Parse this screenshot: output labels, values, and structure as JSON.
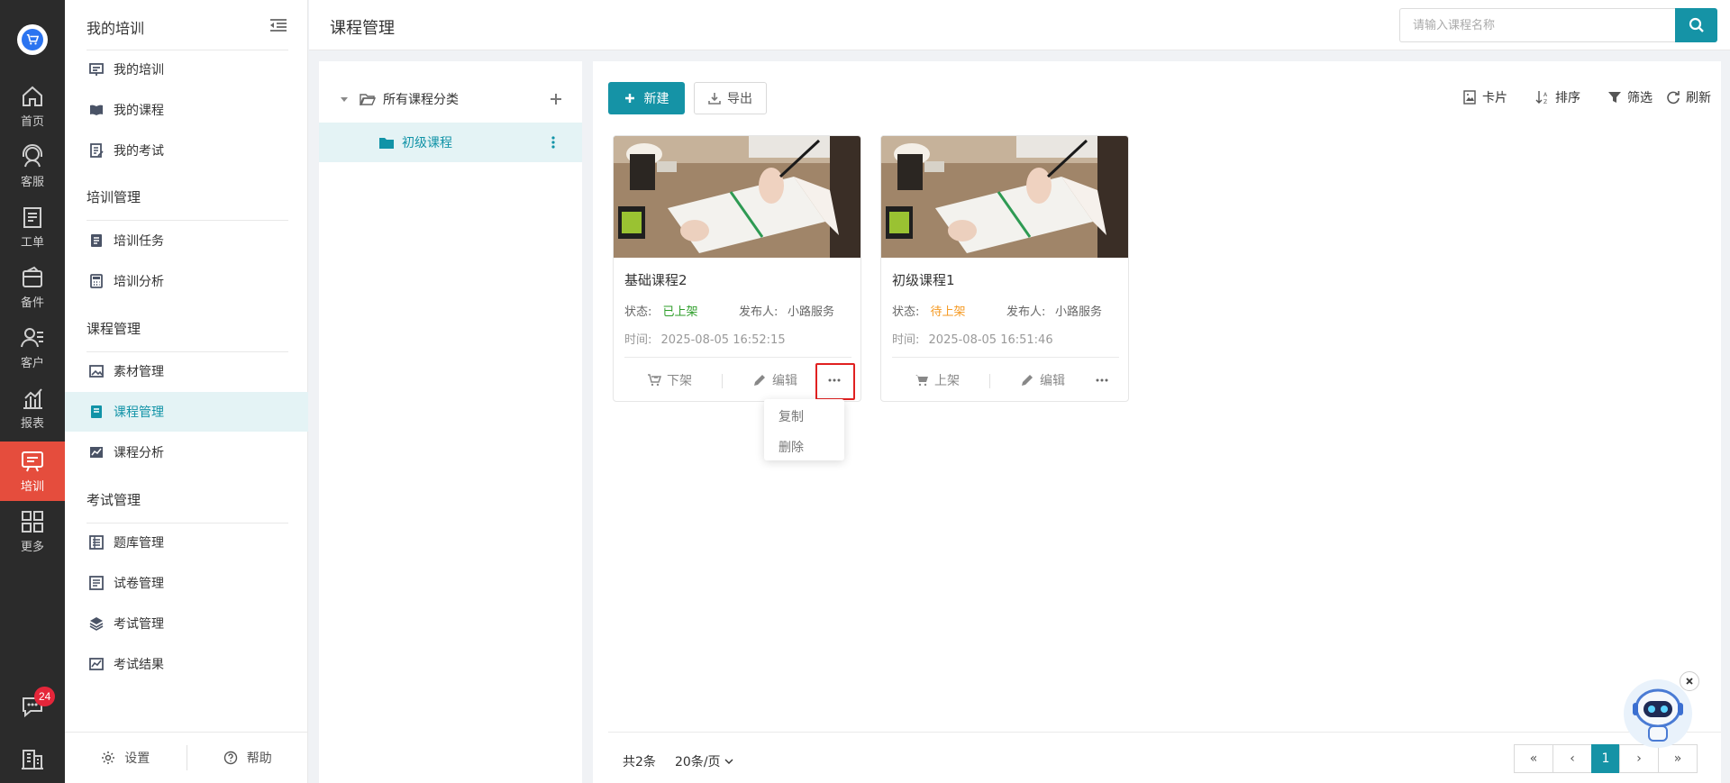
{
  "rail": {
    "items": [
      {
        "label": "首页",
        "icon": "home-icon"
      },
      {
        "label": "客服",
        "icon": "headset-icon"
      },
      {
        "label": "工单",
        "icon": "clipboard-icon"
      },
      {
        "label": "备件",
        "icon": "wallet-icon"
      },
      {
        "label": "客户",
        "icon": "users-icon"
      },
      {
        "label": "报表",
        "icon": "chart-icon"
      },
      {
        "label": "培训",
        "icon": "training-icon"
      },
      {
        "label": "更多",
        "icon": "grid-icon"
      }
    ],
    "active": "培训",
    "badge": "24",
    "accent": "#e54d3d"
  },
  "sidebar": {
    "header": "我的培训",
    "groups": {
      "training_mgmt": "培训管理",
      "course_mgmt": "课程管理",
      "exam_mgmt": "考试管理"
    },
    "items": {
      "my_training": "我的培训",
      "my_courses": "我的课程",
      "my_exams": "我的考试",
      "training_tasks": "培训任务",
      "training_analysis": "培训分析",
      "material_mgmt": "素材管理",
      "course_mgmt": "课程管理",
      "course_analysis": "课程分析",
      "question_bank": "题库管理",
      "paper_mgmt": "试卷管理",
      "exam_mgmt": "考试管理",
      "exam_results": "考试结果"
    },
    "footer": {
      "settings": "设置",
      "help": "帮助"
    }
  },
  "header": {
    "title": "课程管理",
    "search_placeholder": "请输入课程名称",
    "accent": "#1593a6"
  },
  "categories": {
    "root": "所有课程分类",
    "child": "初级课程"
  },
  "toolbar": {
    "new_label": "新建",
    "export_label": "导出",
    "card_label": "卡片",
    "sort_label": "排序",
    "filter_label": "筛选",
    "refresh_label": "刷新"
  },
  "cards": [
    {
      "title": "基础课程2",
      "status_label": "状态:",
      "status": "已上架",
      "publisher_label": "发布人:",
      "publisher": "小路服务",
      "time_label": "时间:",
      "time": "2025-08-05 16:52:15",
      "action1": "下架",
      "action2": "编辑"
    },
    {
      "title": "初级课程1",
      "status_label": "状态:",
      "status": "待上架",
      "publisher_label": "发布人:",
      "publisher": "小路服务",
      "time_label": "时间:",
      "time": "2025-08-05 16:51:46",
      "action1": "上架",
      "action2": "编辑"
    }
  ],
  "dropdown": {
    "copy": "复制",
    "delete": "删除"
  },
  "pagination": {
    "total": "共2条",
    "page_size": "20条/页",
    "first": "«",
    "prev": "‹",
    "current": "1",
    "next": "›",
    "last": "»"
  }
}
